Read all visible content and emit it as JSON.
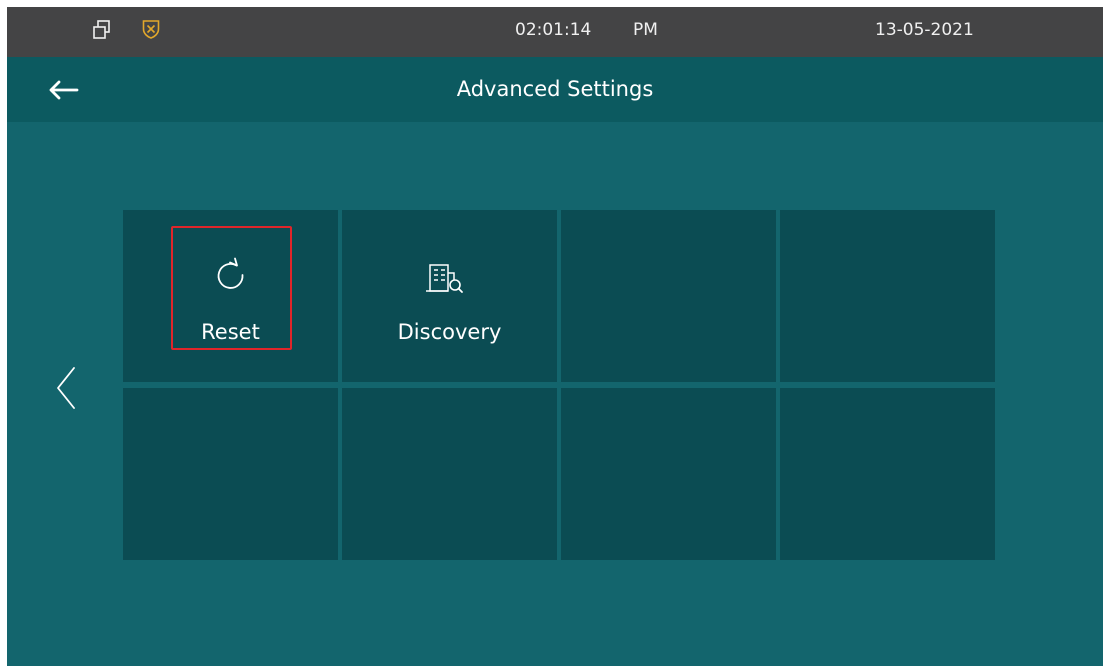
{
  "status_bar": {
    "time": "02:01:14",
    "meridiem": "PM",
    "date": "13-05-2021",
    "icons": [
      "window-icon",
      "shield-icon"
    ]
  },
  "header": {
    "back_icon": "arrow-left-icon",
    "title": "Advanced Settings"
  },
  "navigation": {
    "prev_icon": "chevron-left-icon"
  },
  "grid": {
    "tiles": [
      {
        "label": "Reset",
        "icon": "reset-icon",
        "highlighted": true
      },
      {
        "label": "Discovery",
        "icon": "discovery-icon"
      },
      {
        "label": ""
      },
      {
        "label": ""
      },
      {
        "label": ""
      },
      {
        "label": ""
      },
      {
        "label": ""
      },
      {
        "label": ""
      }
    ]
  },
  "colors": {
    "background": "#13656d",
    "status_bar": "#444445",
    "title_bar": "#0c5a60",
    "tile": "#0b4c53",
    "highlight": "#e0252a",
    "shield_icon": "#e3a82b"
  }
}
